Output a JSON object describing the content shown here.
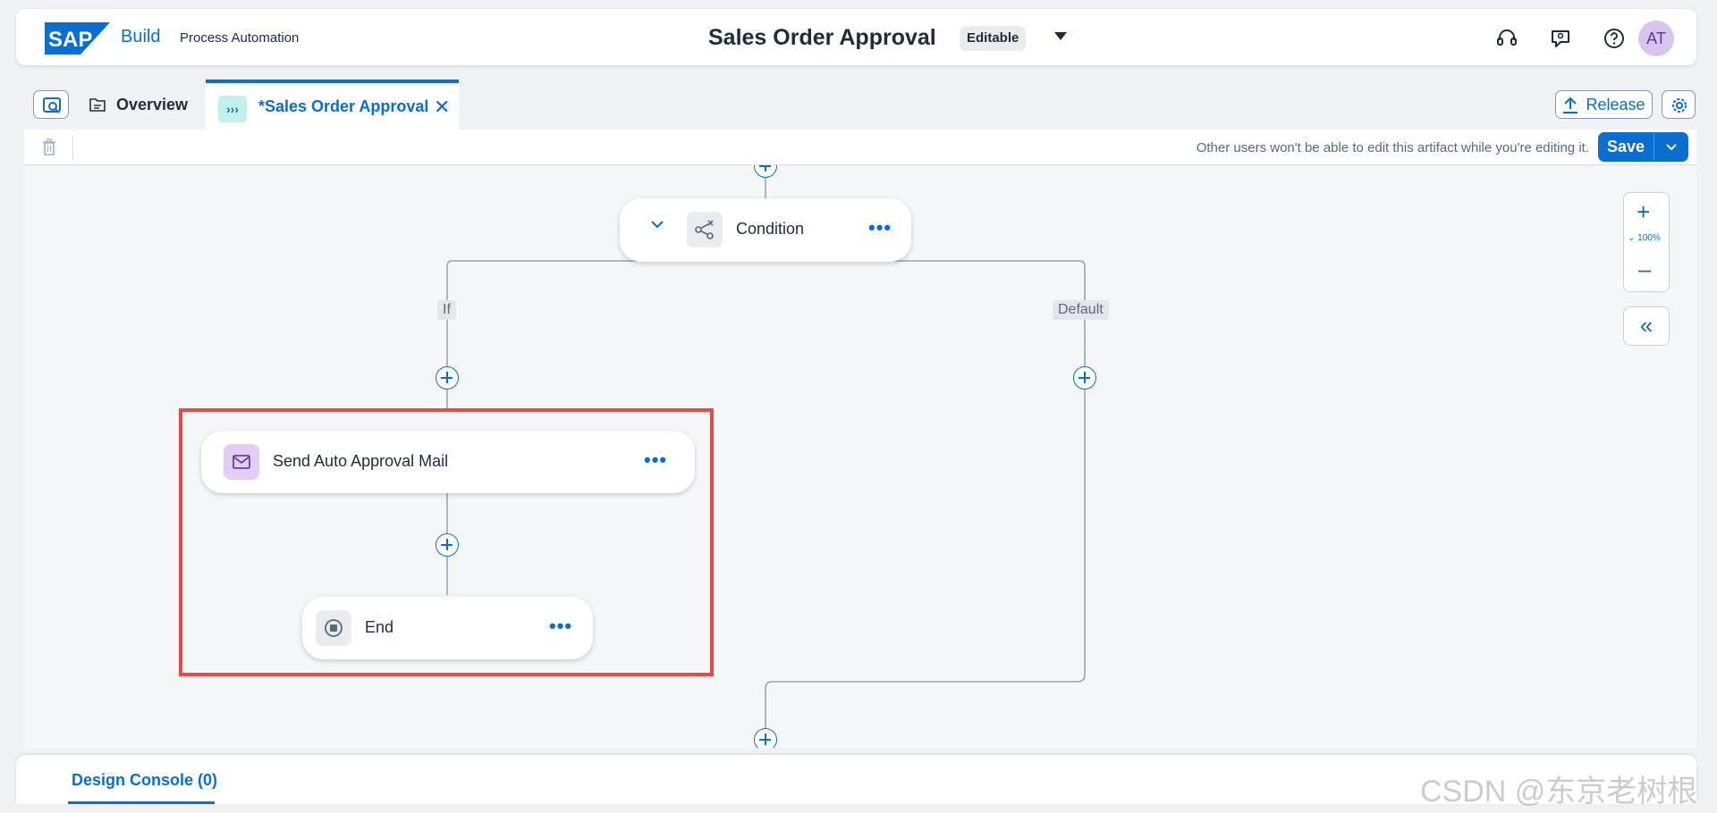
{
  "shell": {
    "logo_text": "SAP",
    "brand": "Build",
    "product": "Process Automation",
    "title": "Sales Order Approval",
    "status_badge": "Editable",
    "avatar_initials": "AT",
    "icons": [
      "headset-icon",
      "feedback-icon",
      "help-icon"
    ]
  },
  "tabs": {
    "overview_label": "Overview",
    "active_label": "*Sales Order Approval",
    "active_icon_glyph": "›››"
  },
  "actions": {
    "release_label": "Release",
    "save_label": "Save"
  },
  "toolbar": {
    "info_text": "Other users won't be able to edit this artifact while you're editing it."
  },
  "canvas": {
    "condition_label": "Condition",
    "branch_if": "If",
    "branch_default": "Default",
    "mail_step_label": "Send Auto Approval Mail",
    "end_label": "End",
    "more_glyph": "•••",
    "zoom_level": "100%"
  },
  "console": {
    "tab_label": "Design Console (0)"
  },
  "watermark": "CSDN @东京老树根",
  "colors": {
    "accent": "#0a6ed1",
    "highlight": "#e84a4a",
    "avatar_bg": "#d9c4f0",
    "mail_icon_bg": "#e2cdf4"
  }
}
